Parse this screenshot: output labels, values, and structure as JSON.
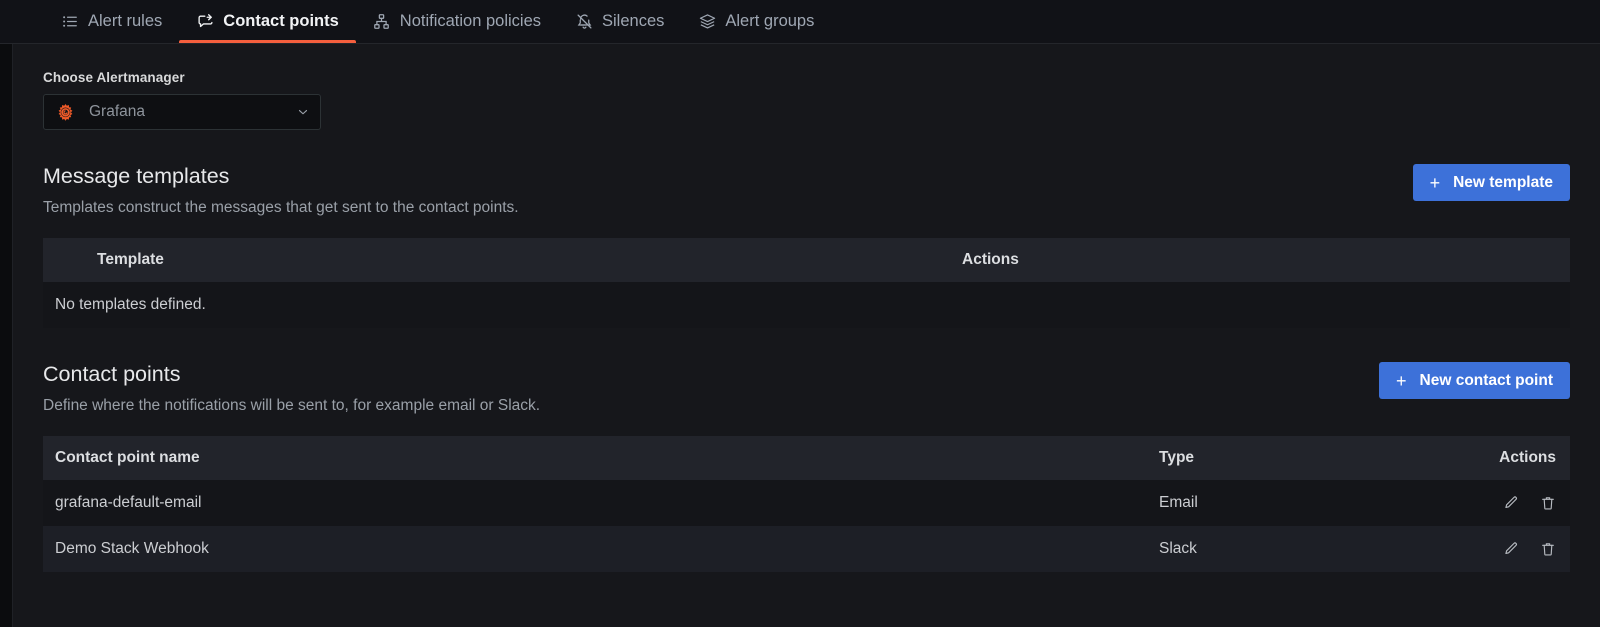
{
  "tabs": [
    {
      "label": "Alert rules",
      "icon": "list-icon",
      "active": false
    },
    {
      "label": "Contact points",
      "icon": "comment-alt-share-icon",
      "active": true
    },
    {
      "label": "Notification policies",
      "icon": "sitemap-icon",
      "active": false
    },
    {
      "label": "Silences",
      "icon": "bell-slash-icon",
      "active": false
    },
    {
      "label": "Alert groups",
      "icon": "layer-group-icon",
      "active": false
    }
  ],
  "alertmanager": {
    "label": "Choose Alertmanager",
    "selected": "Grafana",
    "logo_icon": "grafana-logo-icon",
    "chevron_icon": "chevron-down-icon"
  },
  "message_templates": {
    "title": "Message templates",
    "subtitle": "Templates construct the messages that get sent to the contact points.",
    "new_button": "New template",
    "new_button_icon": "plus-icon",
    "columns": [
      "Template",
      "Actions"
    ],
    "empty_text": "No templates defined.",
    "rows": []
  },
  "contact_points": {
    "title": "Contact points",
    "subtitle": "Define where the notifications will be sent to, for example email or Slack.",
    "new_button": "New contact point",
    "new_button_icon": "plus-icon",
    "columns": [
      "Contact point name",
      "Type",
      "Actions"
    ],
    "rows": [
      {
        "name": "grafana-default-email",
        "type": "Email",
        "edit_icon": "pencil-icon",
        "delete_icon": "trash-icon"
      },
      {
        "name": "Demo Stack Webhook",
        "type": "Slack",
        "edit_icon": "pencil-icon",
        "delete_icon": "trash-icon"
      }
    ]
  },
  "colors": {
    "accent": "#f55f3e",
    "primary_button": "#3d71d9",
    "page_background": "#0b0c0e",
    "panel_background": "#16171b",
    "table_header": "#22242b"
  }
}
